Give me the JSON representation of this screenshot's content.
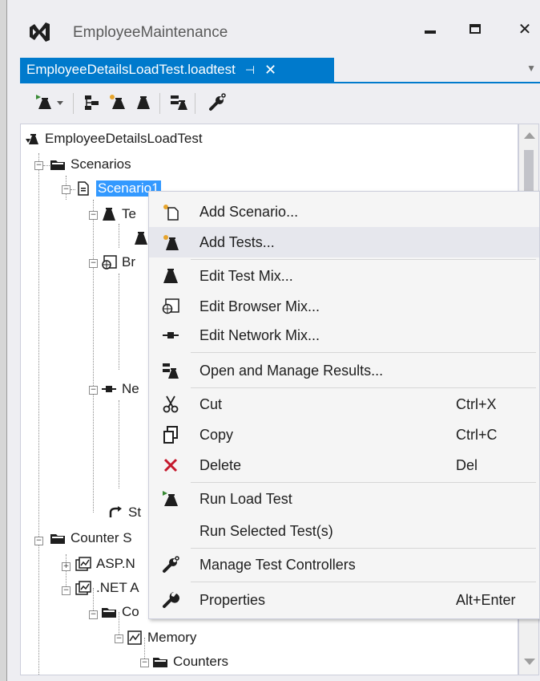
{
  "window": {
    "title": "EmployeeMaintenance",
    "minimize_glyph": "▬",
    "maximize_glyph": "☐",
    "close_glyph": "✕"
  },
  "tab": {
    "label": "EmployeeDetailsLoadTest.loadtest",
    "pin_glyph": "⊣",
    "close_glyph": "✕",
    "dropdown_glyph": "▼",
    "accent_color": "#007acc"
  },
  "toolbar": {
    "icons": [
      "run-load-test-icon",
      "dropdown-arrow-icon",
      "add-scenario-icon",
      "add-tests-icon",
      "open-results-icon",
      "manage-controllers-icon"
    ]
  },
  "tree": {
    "root": "EmployeeDetailsLoadTest",
    "scenarios": "Scenarios",
    "scenario1": "Scenario1",
    "test_mix_partial": "Te",
    "browser_mix_partial": "Br",
    "network_mix_partial": "Ne",
    "step_partial": "St",
    "counter_sets_partial": "Counter S",
    "asp_partial": "ASP.N",
    "dotnet_partial": ".NET A",
    "counter_category_partial": "Co",
    "memory": "Memory",
    "counters": "Counters"
  },
  "context_menu": {
    "items": [
      {
        "label": "Add Scenario...",
        "shortcut": "",
        "icon": "add-scenario-icon"
      },
      {
        "label": "Add Tests...",
        "shortcut": "",
        "icon": "add-tests-icon"
      },
      {
        "label": "Edit Test Mix...",
        "shortcut": "",
        "icon": "flask-icon"
      },
      {
        "label": "Edit Browser Mix...",
        "shortcut": "",
        "icon": "browser-icon"
      },
      {
        "label": "Edit Network Mix...",
        "shortcut": "",
        "icon": "network-icon"
      },
      {
        "label": "Open and Manage Results...",
        "shortcut": "",
        "icon": "results-icon"
      },
      {
        "label": "Cut",
        "shortcut": "Ctrl+X",
        "icon": "scissors-icon"
      },
      {
        "label": "Copy",
        "shortcut": "Ctrl+C",
        "icon": "copy-icon"
      },
      {
        "label": "Delete",
        "shortcut": "Del",
        "icon": "delete-icon"
      },
      {
        "label": "Run Load Test",
        "shortcut": "",
        "icon": "run-load-test-icon"
      },
      {
        "label": "Run Selected Test(s)",
        "shortcut": "",
        "icon": ""
      },
      {
        "label": "Manage Test Controllers",
        "shortcut": "",
        "icon": "controllers-icon"
      },
      {
        "label": "Properties",
        "shortcut": "Alt+Enter",
        "icon": "wrench-icon"
      }
    ]
  }
}
